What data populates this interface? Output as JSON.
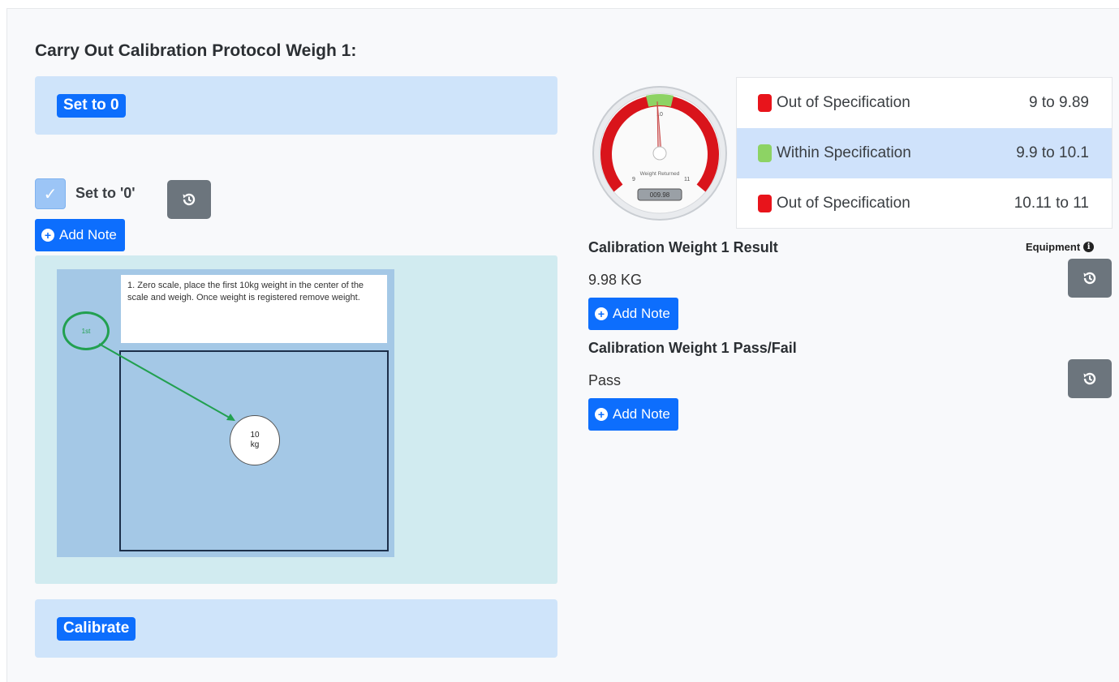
{
  "page": {
    "title": "Carry Out Calibration Protocol Weigh 1:"
  },
  "sections": {
    "set_to_zero": "Set to 0",
    "calibrate": "Calibrate"
  },
  "set_zero_check": {
    "label": "Set to '0'",
    "checked": true
  },
  "add_note_label": "Add Note",
  "diagram": {
    "instruction": "1. Zero scale, place the first 10kg weight in the center of the scale and weigh. Once weight is registered remove weight.",
    "step_marker": "1st",
    "weight_value": "10",
    "weight_unit": "kg"
  },
  "gauge": {
    "caption": "Weight Returned",
    "readout": "009.98",
    "scale_min": "9",
    "scale_max": "11",
    "scale_mid": "10",
    "value": 9.98,
    "min": 9,
    "max": 11
  },
  "spec_table": [
    {
      "label": "Out of Specification",
      "range": "9 to 9.89",
      "color": "#e8141b",
      "active": false
    },
    {
      "label": "Within Specification",
      "range": "9.9 to 10.1",
      "color": "#8dd364",
      "active": true
    },
    {
      "label": "Out of Specification",
      "range": "10.11 to 11",
      "color": "#e8141b",
      "active": false
    }
  ],
  "results": {
    "equipment_label": "Equipment",
    "weight_result": {
      "title": "Calibration Weight 1 Result",
      "value": "9.98 KG"
    },
    "pass_fail": {
      "title": "Calibration Weight 1 Pass/Fail",
      "value": "Pass"
    }
  },
  "colors": {
    "primary": "#0d6efd",
    "secondary": "#6c757d",
    "section_bg": "#cfe4fa",
    "panel_bg": "#d1ebf0"
  }
}
